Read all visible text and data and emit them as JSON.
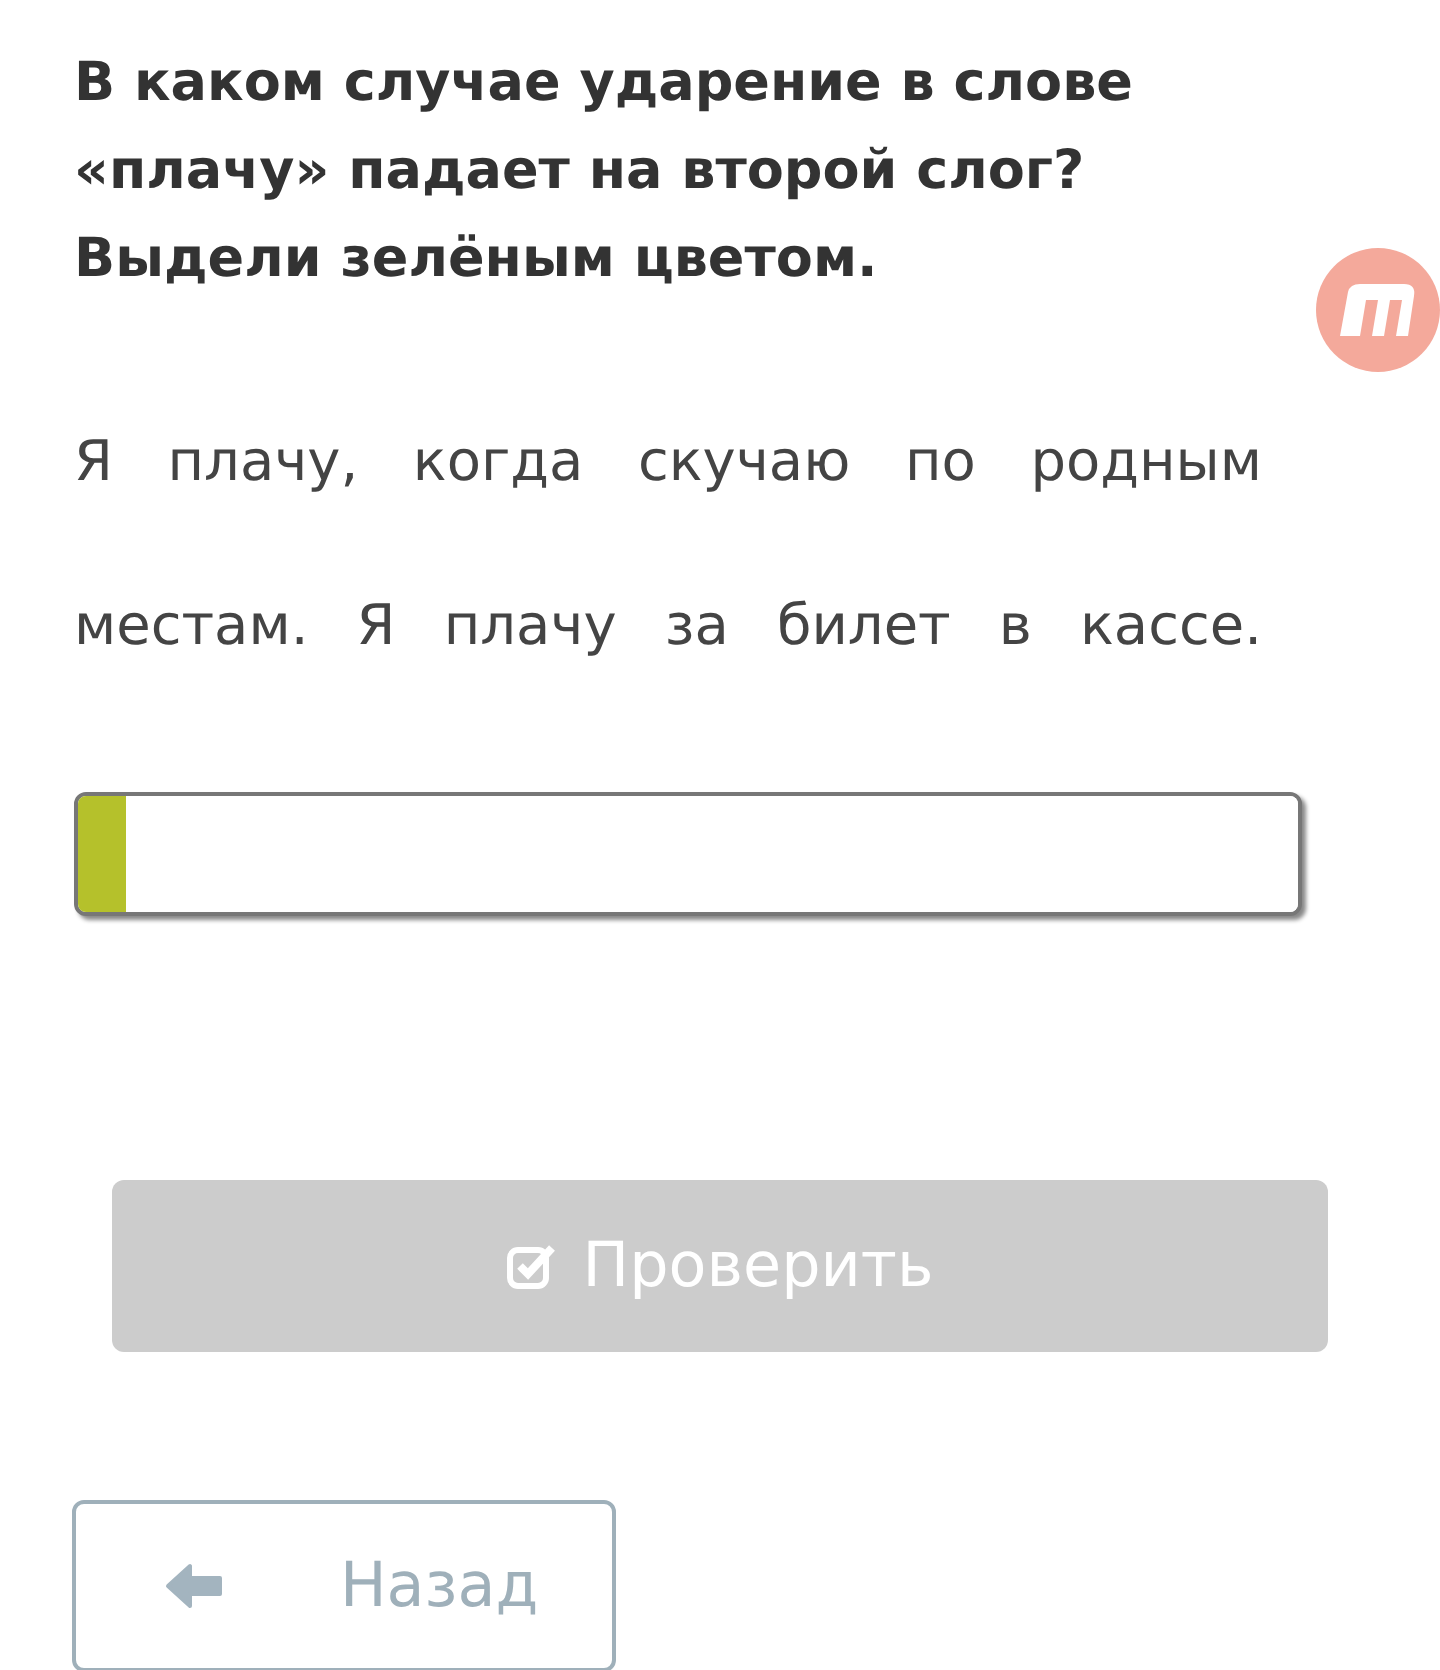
{
  "question": "В каком случае ударение в слове «плачу» падает на второй слог? Выдели зелёным цветом.",
  "sentence": "Я плачу, когда скучаю по родным местам. Я плачу за билет в кассе.",
  "check_button": {
    "label": "Проверить",
    "disabled": true
  },
  "back_button": {
    "label": "Назад"
  }
}
